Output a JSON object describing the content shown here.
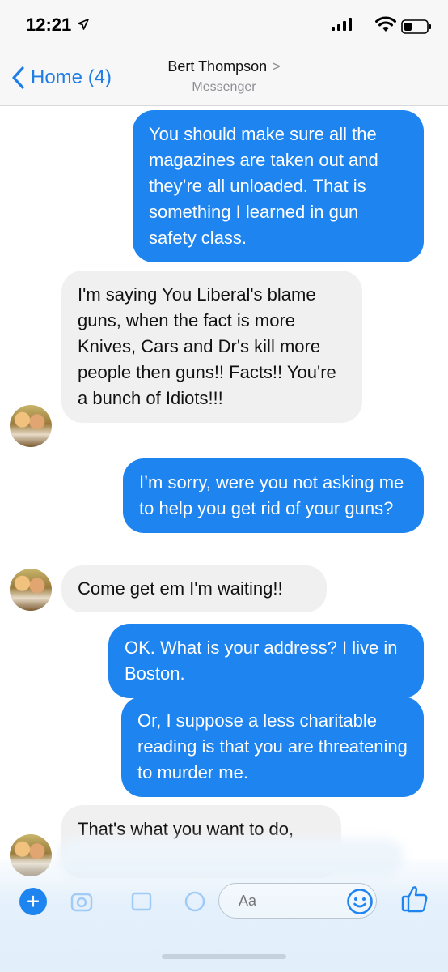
{
  "status_bar": {
    "time": "12:21"
  },
  "nav": {
    "back_label": "Home (4)",
    "contact_name": "Bert Thompson",
    "chevron": ">",
    "subtitle": "Messenger"
  },
  "messages": [
    {
      "dir": "out",
      "text": "You should make sure all the magazines are taken out and they’re all unloaded. That is something I learned in gun safety class."
    },
    {
      "dir": "in",
      "text": "I'm saying You Liberal's blame guns, when the fact is more Knives, Cars and Dr's kill more people then guns!! Facts!! You're a bunch of Idiots!!!"
    },
    {
      "dir": "out",
      "text": "I’m sorry, were you not asking me to help you get rid of your guns?"
    },
    {
      "dir": "in",
      "text": "Come get em I'm waiting!!"
    },
    {
      "dir": "out",
      "text": "OK. What is your address? I live in Boston."
    },
    {
      "dir": "out",
      "text": "Or, I suppose a less charitable reading is that you are threatening to murder me."
    },
    {
      "dir": "in",
      "text": "That's what you want to do,"
    }
  ],
  "composer": {
    "placeholder": "Aa",
    "plus_label": "+"
  },
  "colors": {
    "accent": "#1e84f0",
    "incoming_bubble": "#f0f0f1"
  },
  "icons": [
    "location-arrow-icon",
    "signal-icon",
    "wifi-icon",
    "battery-icon",
    "back-chevron-icon",
    "plus-icon",
    "camera-icon",
    "gallery-icon",
    "mic-icon",
    "smile-icon",
    "thumbs-up-icon"
  ]
}
